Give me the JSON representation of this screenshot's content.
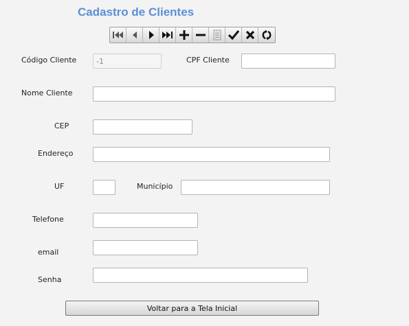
{
  "title": "Cadastro de Clientes",
  "toolbar": {
    "buttons": [
      {
        "icon": "first-record-icon"
      },
      {
        "icon": "previous-record-icon"
      },
      {
        "icon": "next-record-icon"
      },
      {
        "icon": "last-record-icon"
      },
      {
        "icon": "insert-record-icon"
      },
      {
        "icon": "delete-record-icon"
      },
      {
        "icon": "edit-record-icon"
      },
      {
        "icon": "post-record-icon"
      },
      {
        "icon": "cancel-edit-icon"
      },
      {
        "icon": "refresh-icon"
      }
    ]
  },
  "form": {
    "codigo": {
      "label": "Código Cliente",
      "value": "-1"
    },
    "cpf": {
      "label": "CPF Cliente",
      "value": ""
    },
    "nome": {
      "label": "Nome Cliente",
      "value": ""
    },
    "cep": {
      "label": "CEP",
      "value": ""
    },
    "endereco": {
      "label": "Endereço",
      "value": ""
    },
    "uf": {
      "label": "UF",
      "value": ""
    },
    "municipio": {
      "label": "Município",
      "value": ""
    },
    "telefone": {
      "label": "Telefone",
      "value": ""
    },
    "email": {
      "label": "email",
      "value": ""
    },
    "senha": {
      "label": "Senha",
      "value": ""
    }
  },
  "back_button": {
    "label": "Voltar para a Tela Inicial"
  }
}
